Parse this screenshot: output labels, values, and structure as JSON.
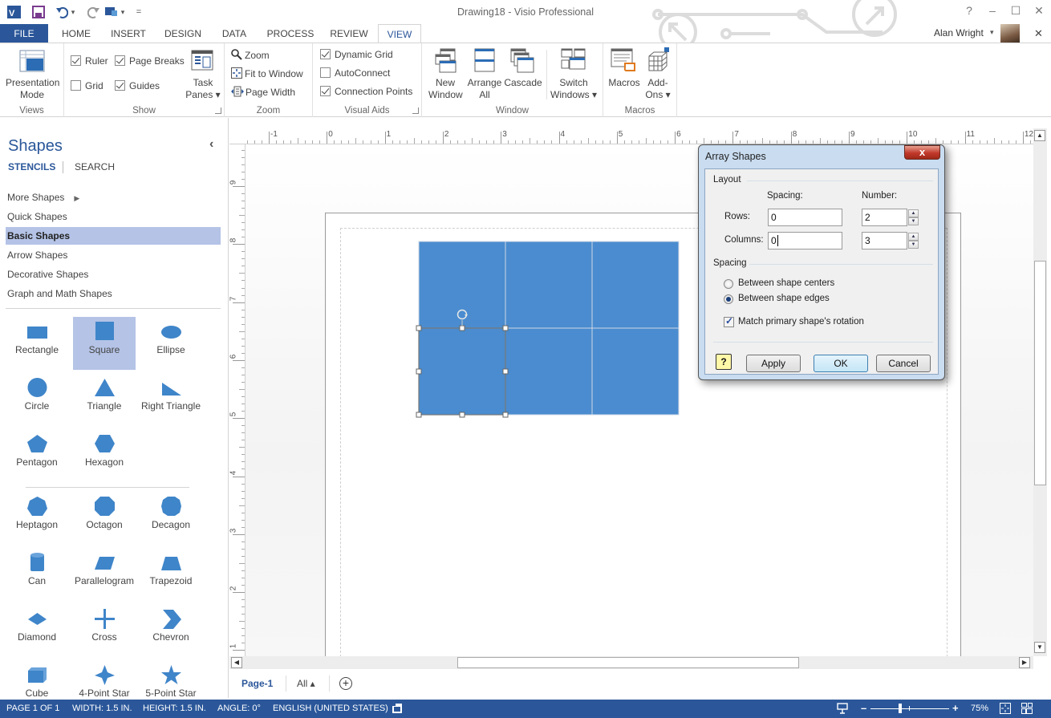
{
  "window": {
    "title": "Drawing18 - Visio Professional",
    "help": "?",
    "minimize": "–",
    "maximize": "☐",
    "close": "✕",
    "ribbon_close": "✕",
    "user_name": "Alan Wright",
    "user_dropdown": "▾"
  },
  "quick_access": {
    "undo_arrow": "▾",
    "more": "▾",
    "customize": "="
  },
  "tabs": [
    {
      "label": "FILE"
    },
    {
      "label": "HOME"
    },
    {
      "label": "INSERT"
    },
    {
      "label": "DESIGN"
    },
    {
      "label": "DATA"
    },
    {
      "label": "PROCESS"
    },
    {
      "label": "REVIEW"
    },
    {
      "label": "VIEW",
      "active": true
    }
  ],
  "ribbon": {
    "views": {
      "label": "Views",
      "presentation_mode": [
        "Presentation",
        "Mode"
      ]
    },
    "show": {
      "label": "Show",
      "ruler": {
        "label": "Ruler",
        "checked": true
      },
      "page_breaks": {
        "label": "Page Breaks",
        "checked": true
      },
      "grid": {
        "label": "Grid",
        "checked": false
      },
      "guides": {
        "label": "Guides",
        "checked": true
      },
      "task_panes": [
        "Task",
        "Panes ▾"
      ]
    },
    "zoom": {
      "label": "Zoom",
      "zoom": "Zoom",
      "fit_to_window": "Fit to Window",
      "page_width": "Page Width"
    },
    "visual_aids": {
      "label": "Visual Aids",
      "dynamic_grid": {
        "label": "Dynamic Grid",
        "checked": true
      },
      "autoconnect": {
        "label": "AutoConnect",
        "checked": false
      },
      "connection_points": {
        "label": "Connection Points",
        "checked": true
      }
    },
    "window": {
      "label": "Window",
      "new_window": [
        "New",
        "Window"
      ],
      "arrange_all": [
        "Arrange",
        "All"
      ],
      "cascade": "Cascade",
      "switch_windows": [
        "Switch",
        "Windows ▾"
      ]
    },
    "macros": {
      "label": "Macros",
      "macros": "Macros",
      "add_ons": [
        "Add-",
        "Ons ▾"
      ]
    }
  },
  "shapes_pane": {
    "title": "Shapes",
    "collapse": "‹",
    "tab_stencils": "STENCILS",
    "tab_search": "SEARCH",
    "stencils": [
      {
        "label": "More Shapes",
        "arrow": "▶"
      },
      {
        "label": "Quick Shapes"
      },
      {
        "label": "Basic Shapes",
        "selected": true
      },
      {
        "label": "Arrow Shapes"
      },
      {
        "label": "Decorative Shapes"
      },
      {
        "label": "Graph and Math Shapes"
      }
    ],
    "shapes": [
      {
        "label": "Rectangle",
        "icon": "rectangle"
      },
      {
        "label": "Square",
        "icon": "square",
        "selected": true
      },
      {
        "label": "Ellipse",
        "icon": "ellipse"
      },
      {
        "label": "Circle",
        "icon": "circle"
      },
      {
        "label": "Triangle",
        "icon": "triangle"
      },
      {
        "label": "Right Triangle",
        "icon": "right-triangle"
      },
      {
        "label": "Pentagon",
        "icon": "pentagon"
      },
      {
        "label": "Hexagon",
        "icon": "hexagon"
      },
      {
        "label": "Heptagon",
        "icon": "heptagon"
      },
      {
        "label": "Octagon",
        "icon": "octagon"
      },
      {
        "label": "Decagon",
        "icon": "decagon"
      },
      {
        "label": "Can",
        "icon": "can"
      },
      {
        "label": "Parallelogram",
        "icon": "parallelogram"
      },
      {
        "label": "Trapezoid",
        "icon": "trapezoid"
      },
      {
        "label": "Diamond",
        "icon": "diamond"
      },
      {
        "label": "Cross",
        "icon": "cross"
      },
      {
        "label": "Chevron",
        "icon": "chevron"
      },
      {
        "label": "Cube",
        "icon": "cube"
      },
      {
        "label": "4-Point Star",
        "icon": "star-4"
      },
      {
        "label": "5-Point Star",
        "icon": "star-5"
      }
    ],
    "shape_color": "#3f85c9"
  },
  "rulers": {
    "horizontal": [
      "-1",
      "0",
      "1",
      "2",
      "3",
      "4",
      "5",
      "6",
      "7",
      "8",
      "9",
      "10",
      "11",
      "12"
    ],
    "vertical": [
      "9",
      "8",
      "7",
      "6",
      "5",
      "4",
      "3",
      "2",
      "1"
    ]
  },
  "drawing": {
    "array_rows": 2,
    "array_columns": 3,
    "fill_color": "#4a8ccf"
  },
  "dialog": {
    "title": "Array Shapes",
    "close": "x",
    "layout_heading": "Layout",
    "spacing_col": "Spacing:",
    "number_col": "Number:",
    "rows_label": "Rows:",
    "rows_spacing": "0",
    "rows_number": "2",
    "columns_label": "Columns:",
    "columns_spacing": "0",
    "columns_number": "3",
    "spacing_heading": "Spacing",
    "between_centers": "Between shape centers",
    "between_edges": "Between shape edges",
    "spacing_selected": "edges",
    "match_rotation": "Match primary shape's rotation",
    "match_rotation_checked": true,
    "help": "?",
    "apply": "Apply",
    "ok": "OK",
    "cancel": "Cancel",
    "spin_up": "▲",
    "spin_down": "▼"
  },
  "page_tabs": {
    "current": "Page-1",
    "all": "All ▴",
    "add": "+"
  },
  "scroll": {
    "up": "▲",
    "left": "◀",
    "right": "▶"
  },
  "status_bar": {
    "page": "PAGE 1 OF 1",
    "width": "WIDTH: 1.5 IN.",
    "height": "HEIGHT: 1.5 IN.",
    "angle": "ANGLE: 0°",
    "language": "ENGLISH (UNITED STATES)",
    "zoom_out": "–",
    "zoom_in": "+",
    "zoom_level": "75%"
  }
}
